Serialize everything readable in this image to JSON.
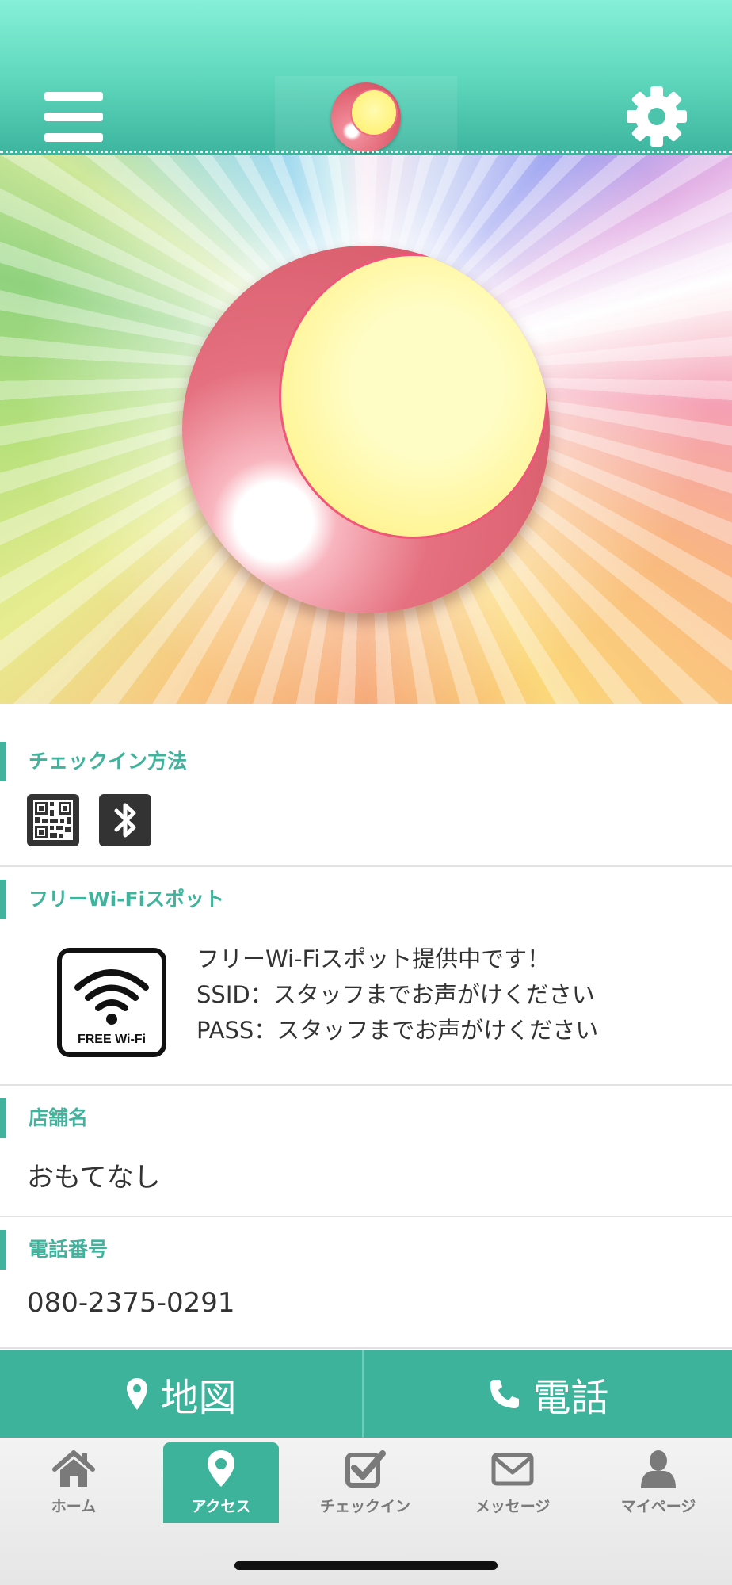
{
  "header": {
    "menu_icon": "hamburger-icon",
    "settings_icon": "gear-icon",
    "logo": "moon-logo"
  },
  "sections": {
    "checkin": {
      "title": "チェックイン方法",
      "methods": [
        "qr-code-icon",
        "bluetooth-icon"
      ]
    },
    "wifi": {
      "title": "フリーWi-Fiスポット",
      "icon_label": "FREE Wi-Fi",
      "lines": [
        "フリーWi-Fiスポット提供中です！",
        "SSID：スタッフまでお声がけください",
        "PASS：スタッフまでお声がけください"
      ]
    },
    "store": {
      "title": "店舗名",
      "value": "おもてなし"
    },
    "phone": {
      "title": "電話番号",
      "value": "080-2375-0291"
    }
  },
  "actions": {
    "map_label": "地図",
    "tel_label": "電話"
  },
  "tabbar": {
    "items": [
      {
        "label": "ホーム",
        "icon": "home-icon"
      },
      {
        "label": "アクセス",
        "icon": "map-pin-icon",
        "active": true
      },
      {
        "label": "チェックイン",
        "icon": "checkbox-icon"
      },
      {
        "label": "メッセージ",
        "icon": "envelope-icon"
      },
      {
        "label": "マイページ",
        "icon": "person-icon"
      }
    ]
  },
  "colors": {
    "accent": "#41b39c",
    "header_top": "#86f0d8",
    "header_bottom": "#3db49e"
  }
}
